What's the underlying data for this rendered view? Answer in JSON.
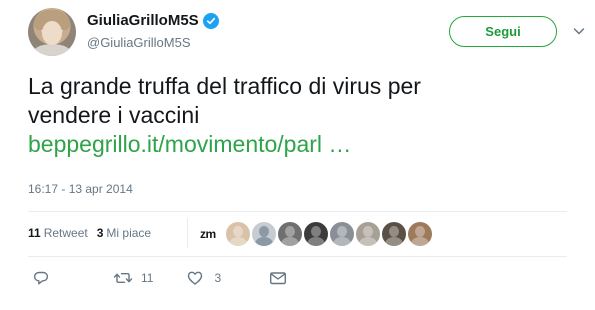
{
  "tweet": {
    "display_name": "GiuliaGrilloM5S",
    "handle": "@GiuliaGrilloM5S",
    "text_line1": "La grande truffa del traffico di virus per",
    "text_line2": "vendere i vaccini",
    "link": "beppegrillo.it/movimento/parl  …",
    "timestamp": "16:17 - 13 apr 2014"
  },
  "follow_button": {
    "label": "Segui"
  },
  "stats": {
    "retweet_count": "11",
    "retweet_label": "Retweet",
    "like_count": "3",
    "like_label": "Mi piace"
  },
  "likers": {
    "first_handle": "zm",
    "avatars": [
      {
        "icon": "avatar-photo",
        "color": "#d9c2a8"
      },
      {
        "icon": "default-avatar",
        "color": "#c7ccd1"
      },
      {
        "icon": "avatar-photo",
        "color": "#6f6f6f"
      },
      {
        "icon": "avatar-photo",
        "color": "#3b3b3b"
      },
      {
        "icon": "avatar-photo",
        "color": "#8a8f97"
      },
      {
        "icon": "avatar-photo",
        "color": "#a7a096"
      },
      {
        "icon": "avatar-photo",
        "color": "#5b5046"
      },
      {
        "icon": "avatar-photo",
        "color": "#9c7a5a"
      }
    ]
  },
  "actions": {
    "reply_icon": "reply-icon",
    "retweet_icon": "retweet-icon",
    "retweet_count": "11",
    "like_icon": "heart-icon",
    "like_count": "3",
    "dm_icon": "envelope-icon"
  },
  "colors": {
    "link": "#2fa34a",
    "follow_border": "#26a541",
    "verified": "#1da1f2",
    "muted": "#657786",
    "text": "#14171a"
  }
}
